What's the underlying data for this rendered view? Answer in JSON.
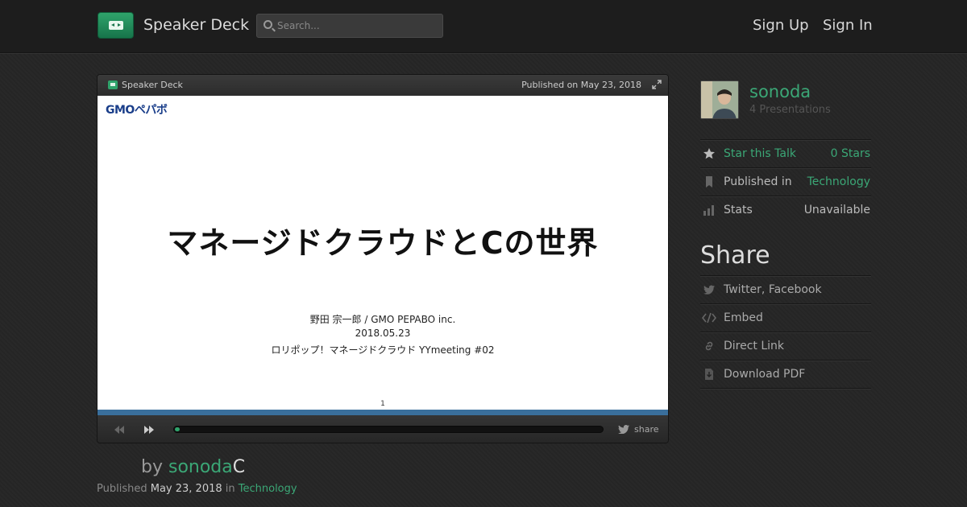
{
  "header": {
    "brand": "Speaker Deck",
    "search_placeholder": "Search...",
    "signup": "Sign Up",
    "signin": "Sign In"
  },
  "player": {
    "brand": "Speaker Deck",
    "published": "Published on May 23, 2018",
    "share_label": "share",
    "progress_fraction": 0.01
  },
  "slide": {
    "logo": "GMOペパボ",
    "title": "マネージドクラウドとCの世界",
    "author_line": "野田 宗一郎 / GMO PEPABO inc.",
    "date": "2018.05.23",
    "event": "ロリポップ！マネージドクラウド YYmeeting #02",
    "page": "1"
  },
  "byline": {
    "by": "by ",
    "author": "sonoda",
    "suffix": "C",
    "published_label": "Published ",
    "date": "May 23, 2018",
    "in_label": " in ",
    "category": "Technology"
  },
  "sidebar": {
    "username": "sonoda",
    "presentations": "4 Presentations",
    "rows": [
      {
        "label": "Star this Talk",
        "value": "0 Stars"
      },
      {
        "label": "Published in",
        "value": "Technology"
      },
      {
        "label": "Stats",
        "value": "Unavailable"
      }
    ],
    "share_heading": "Share",
    "share_items": [
      {
        "label": "Twitter, Facebook"
      },
      {
        "label": "Embed"
      },
      {
        "label": "Direct Link"
      },
      {
        "label": "Download PDF"
      }
    ]
  },
  "colors": {
    "accent": "#3ba776",
    "slide_stripe": "#3a6f9c"
  }
}
